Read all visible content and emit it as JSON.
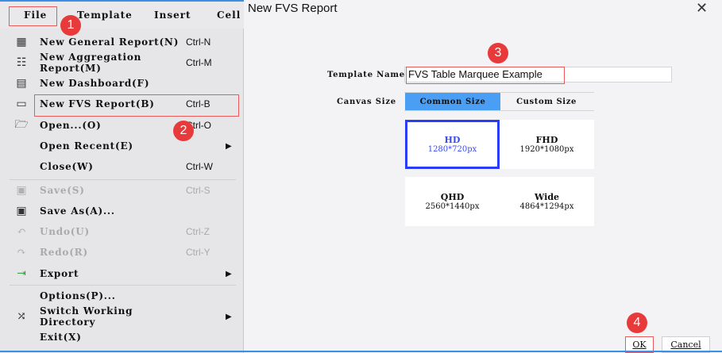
{
  "menubar": {
    "items": [
      "File",
      "Template",
      "Insert",
      "Cell"
    ]
  },
  "file_menu": {
    "items": [
      {
        "label": "New General Report(N)",
        "shortcut": "Ctrl-N",
        "icon": "grid-report-icon",
        "enabled": true
      },
      {
        "label": "New Aggregation Report(M)",
        "shortcut": "Ctrl-M",
        "icon": "aggregation-report-icon",
        "enabled": true
      },
      {
        "label": "New Dashboard(F)",
        "shortcut": "",
        "icon": "dashboard-icon",
        "enabled": true
      },
      {
        "label": "New FVS Report(B)",
        "shortcut": "Ctrl-B",
        "icon": "monitor-icon",
        "enabled": true
      },
      {
        "label": "Open...(O)",
        "shortcut": "Ctrl-O",
        "icon": "folder-open-icon",
        "enabled": true
      },
      {
        "label": "Open Recent(E)",
        "shortcut": "",
        "icon": "",
        "enabled": true,
        "submenu": true
      },
      {
        "label": "Close(W)",
        "shortcut": "Ctrl-W",
        "icon": "",
        "enabled": true
      },
      {
        "label": "Save(S)",
        "shortcut": "Ctrl-S",
        "icon": "save-icon",
        "enabled": false
      },
      {
        "label": "Save As(A)...",
        "shortcut": "",
        "icon": "save-as-icon",
        "enabled": true
      },
      {
        "label": "Undo(U)",
        "shortcut": "Ctrl-Z",
        "icon": "undo-icon",
        "enabled": false
      },
      {
        "label": "Redo(R)",
        "shortcut": "Ctrl-Y",
        "icon": "redo-icon",
        "enabled": false
      },
      {
        "label": "Export",
        "shortcut": "",
        "icon": "export-icon",
        "enabled": true,
        "submenu": true
      },
      {
        "label": "Options(P)...",
        "shortcut": "",
        "icon": "",
        "enabled": true
      },
      {
        "label": "Switch Working Directory",
        "shortcut": "",
        "icon": "shuffle-icon",
        "enabled": true,
        "submenu": true
      },
      {
        "label": "Exit(X)",
        "shortcut": "",
        "icon": "",
        "enabled": true
      }
    ]
  },
  "dialog": {
    "title": "New FVS Report",
    "template_name_label": "Template Name",
    "template_name_value": "FVS Table Marquee Example",
    "canvas_size_label": "Canvas Size",
    "tabs": [
      "Common Size",
      "Custom Size"
    ],
    "sizes": [
      {
        "name": "HD",
        "dims": "1280*720px",
        "selected": true
      },
      {
        "name": "FHD",
        "dims": "1920*1080px"
      },
      {
        "name": "QHD",
        "dims": "2560*1440px"
      },
      {
        "name": "Wide",
        "dims": "4864*1294px"
      }
    ],
    "ok_label": "OK",
    "cancel_label": "Cancel"
  },
  "steps": [
    "1",
    "2",
    "3",
    "4"
  ],
  "colors": {
    "accent": "#4a9ff5",
    "highlight": "#e95b5b",
    "badge": "#e83a3a",
    "selected_border": "#2b3cf5"
  }
}
